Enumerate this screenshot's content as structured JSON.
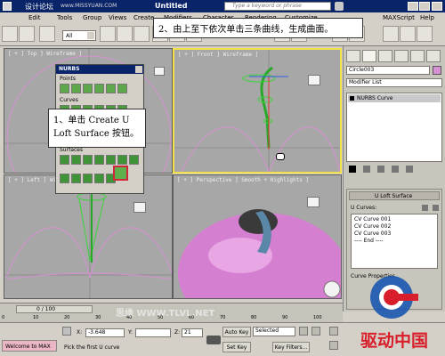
{
  "window": {
    "title": "Untitled",
    "search_placeholder": "Type a keyword or phrase",
    "maxscript_label": "MAXScript",
    "help_label": "Help"
  },
  "menu": [
    "Edit",
    "Tools",
    "Group",
    "Views",
    "Create",
    "Modifiers",
    "Character",
    "Rendering",
    "Customize"
  ],
  "toolbar": {
    "selection_filter": "All"
  },
  "viewports": {
    "top": "[ + ] Top ] Wireframe ]",
    "front": "[ + ] Front ] Wireframe ]",
    "left": "[ + ] Left ] Wireframe ]",
    "perspective": "[ + ] Perspective ] Smooth + Highlights ]"
  },
  "nurbs_toolbox": {
    "title": "NURBS",
    "points_label": "Points",
    "curves_label": "Curves",
    "surfaces_label": "Surfaces"
  },
  "callouts": {
    "step1": "1、单击 Create U Loft Surface 按钮。",
    "step2": "2、由上至下依次单击三条曲线，生成曲面。"
  },
  "command_panel": {
    "object_name": "Circle003",
    "modifier_list": "Modifier List",
    "stack_item": "NURBS Curve",
    "rollout_title": "U Loft Surface",
    "u_curves_label": "U Curves:",
    "u_curves": [
      "CV Curve 001",
      "CV Curve 002",
      "CV Curve 003",
      "---- End ----"
    ],
    "curve_properties_label": "Curve Properties"
  },
  "timeline": {
    "frame_counter": "0 / 100",
    "ticks": [
      "0",
      "10",
      "20",
      "30",
      "40",
      "50",
      "60",
      "70",
      "80",
      "90",
      "100"
    ]
  },
  "status": {
    "welcome_text": "Welcome to MAX",
    "prompt": "Pick the first U curve",
    "x_label": "X:",
    "x_value": "-3.648",
    "y_label": "Y:",
    "y_value": "",
    "z_label": "Z:",
    "z_value": "21",
    "auto_key": "Auto Key",
    "selected": "Selected",
    "set_key": "Set Key",
    "key_filters": "Key Filters..."
  },
  "watermarks": {
    "top_left": "设计论坛",
    "top_url": "www.MISSYUAN.COM",
    "bottom_center": "思缘 WWW.TLVL.NET",
    "brand": "驱动中国"
  },
  "colors": {
    "active_viewport_border": "#f2e14a",
    "highlight_box": "#d0283a",
    "apple_pink": "#d57fd0",
    "wire_green": "#3bd43b",
    "brand_red": "#d81e2a",
    "brand_blue": "#1a56b0",
    "title_blue": "#0a246a"
  }
}
